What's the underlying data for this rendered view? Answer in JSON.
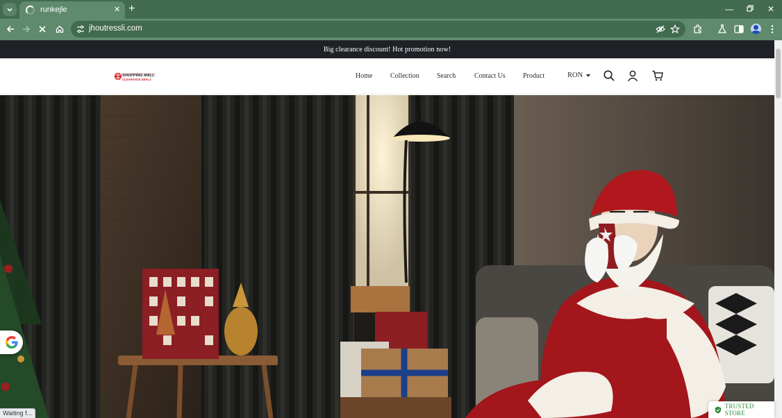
{
  "browser": {
    "tab_title": "runkejle",
    "url": "jhoutressli.com",
    "status_text": "Waiting f..."
  },
  "announcement": "Big clearance discount! Hot promotion now!",
  "header": {
    "logo_alt": "SHOPPING MALL CLEARANCE DEALS",
    "nav": [
      "Home",
      "Collection",
      "Search",
      "Contact Us",
      "Product"
    ],
    "currency": "RON"
  },
  "badges": {
    "trusted_store": "TRUSTED STORE"
  },
  "colors": {
    "chrome_dark": "#436b50",
    "chrome_light": "#5f8a6c",
    "announcement_bg": "#1e2227",
    "trusted_green": "#2e8b3a"
  }
}
